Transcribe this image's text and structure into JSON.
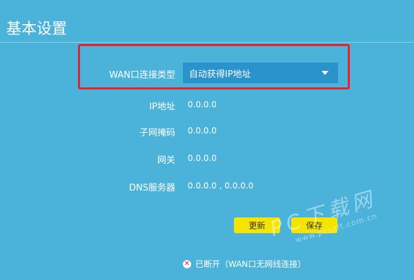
{
  "page": {
    "title": "基本设置"
  },
  "form": {
    "wan_type": {
      "label": "WAN口连接类型",
      "value": "自动获得IP地址"
    },
    "ip": {
      "label": "IP地址",
      "value": "0.0.0.0"
    },
    "subnet": {
      "label": "子网掩码",
      "value": "0.0.0.0"
    },
    "gateway": {
      "label": "网关",
      "value": "0.0.0.0"
    },
    "dns": {
      "label": "DNS服务器",
      "value": "0.0.0.0 , 0.0.0.0"
    }
  },
  "buttons": {
    "update": "更新",
    "save": "保存"
  },
  "status": {
    "icon": "error-icon",
    "text": "已断开（WAN口无网线连接）"
  },
  "watermark": {
    "big": "PC下载网",
    "small": "www.pcsoft.com.cn"
  },
  "colors": {
    "background": "#4bb3da",
    "select_bg": "#2a93cc",
    "highlight_border": "#e2232e",
    "button_bg": "#f5e400"
  }
}
